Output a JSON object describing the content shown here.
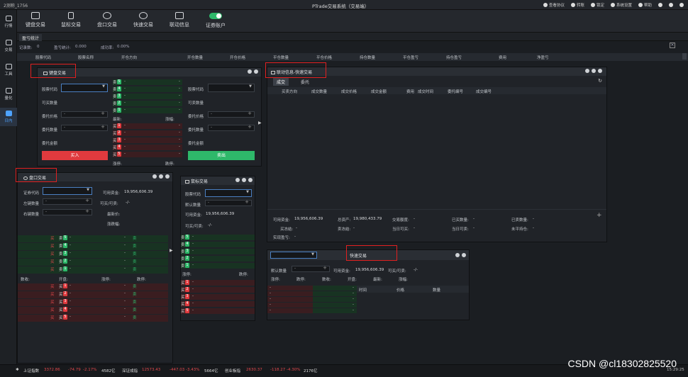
{
  "title_bar": {
    "account": "2测称_1756",
    "app_title": "PTrade交易系统（交易端）",
    "actions": [
      "查看协议",
      "转账",
      "锁定",
      "系统设置",
      "帮助"
    ]
  },
  "left_nav": [
    {
      "label": "行情",
      "icon": "chart-icon"
    },
    {
      "label": "交易",
      "icon": "trade-icon"
    },
    {
      "label": "工具",
      "icon": "toolbox-icon"
    },
    {
      "label": "量化",
      "icon": "quant-icon"
    },
    {
      "label": "日内",
      "icon": "intraday-icon"
    }
  ],
  "toolbar": [
    {
      "label": "键盘交易",
      "icon": "keyboard-icon"
    },
    {
      "label": "鼠标交易",
      "icon": "mouse-icon"
    },
    {
      "label": "盘口交易",
      "icon": "orderbook-icon"
    },
    {
      "label": "快速交易",
      "icon": "lightning-icon"
    },
    {
      "label": "联动信息",
      "icon": "link-icon"
    },
    {
      "label": "证券账户",
      "icon": "toggle-icon"
    }
  ],
  "sub_tab": "盈亏统计",
  "stats": {
    "record_label": "记录数:",
    "record_val": "0",
    "pnl_label": "盈亏统计:",
    "pnl_val": "0.000",
    "rate_label": "成功率:",
    "rate_val": "0.00%"
  },
  "grid_columns": [
    "股票代码",
    "股票名称",
    "开仓方向",
    "开仓数量",
    "开仓价格",
    "平仓数量",
    "平仓价格",
    "持仓数量",
    "平仓盈亏",
    "持仓盈亏",
    "费用",
    "净盈亏"
  ],
  "keyboard_panel": {
    "title": "键盘交易",
    "left_labels": [
      "股票代码",
      "可买数量",
      "委托价格",
      "委托数量",
      "委托金额"
    ],
    "right_labels": [
      "股票代码",
      "可卖数量",
      "委托价格",
      "委托数量",
      "委托金额"
    ],
    "buy_btn": "买入",
    "sell_btn": "卖出",
    "latest_label": "最新:",
    "change_label": "涨幅:",
    "limit_up_label": "涨停:",
    "limit_down_label": "跌停:",
    "dash": "-"
  },
  "panel_quotes": {
    "sell_tag": "卖",
    "buy_tag": "买",
    "levels": [
      "5",
      "4",
      "3",
      "2",
      "1"
    ],
    "levels_buy": [
      "1",
      "2",
      "3",
      "4",
      "5"
    ]
  },
  "orderbook_panel": {
    "title": "盘口交易",
    "labels": [
      "证券代码",
      "左键数量",
      "右键数量"
    ],
    "avail_funds_label": "可用资金:",
    "avail_funds": "19,956,606.39",
    "buy_sell_label": "可买/可卖:",
    "buy_sell_val": "-/-",
    "latest_label": "最新价:",
    "change_label": "涨跌幅:",
    "row_labels": [
      "数收:",
      "开盘:",
      "涨停:",
      "跌停:"
    ]
  },
  "mouse_panel": {
    "title": "鼠标交易",
    "labels": [
      "股票代码",
      "默认数量"
    ],
    "avail_funds_label": "可用资金:",
    "avail_funds": "19,956,606.39",
    "buy_sell_label": "可买/可卖:",
    "buy_sell_val": "-/-",
    "limit_up_label": "涨停:",
    "limit_down_label": "跌停:"
  },
  "link_panel": {
    "title": "联动信息-快速交易",
    "tabs": [
      "成交",
      "委托"
    ],
    "columns": [
      "买卖方向",
      "成交数量",
      "成交价格",
      "成交金额",
      "费用",
      "成交时间",
      "委托编号",
      "成交编号"
    ],
    "summary": {
      "avail_label": "可用资金:",
      "avail": "19,956,606.39",
      "total_label": "总资产:",
      "total": "19,980,433.79",
      "quota_label": "交易额度:",
      "quota": "-",
      "bought_label": "已买数量:",
      "bought": "-",
      "sold_label": "已卖数量:",
      "sold": "-",
      "frozen_buy_label": "买冻结:",
      "frozen_buy": "-",
      "frozen_sell_label": "卖冻结:",
      "frozen_sell": "-",
      "today_buy_label": "当日可买:",
      "today_buy": "-",
      "today_sell_label": "当日可卖:",
      "today_sell": "-",
      "unclosed_label": "未平持仓:",
      "unclosed": "-",
      "realized_label": "实现盈亏:",
      "realized": "-"
    }
  },
  "quick_panel": {
    "title": "快速交易",
    "default_qty_label": "默认数量",
    "avail_funds_label": "可用资金:",
    "avail_funds": "19,956,606.39",
    "buy_sell_label": "可买/可卖:",
    "buy_sell_val": "-/-",
    "row_labels": [
      "涨停:",
      "跌停:",
      "数收:",
      "开盘:",
      "最新:",
      "涨幅:"
    ],
    "columns": [
      "时间",
      "价格",
      "数量"
    ]
  },
  "footer": {
    "items": [
      {
        "name": "上证指数",
        "value": "3372.86",
        "chg": "-74.79",
        "pct": "-2.17%",
        "vol": "4582亿"
      },
      {
        "name": "深证成指",
        "value": "12573.43",
        "chg": "-447.03",
        "pct": "-3.43%",
        "vol": "5664亿"
      },
      {
        "name": "创业板指",
        "value": "2630.37",
        "chg": "-118.27",
        "pct": "-4.30%",
        "vol": "2176亿"
      }
    ],
    "right_time": "15:29:25"
  },
  "watermark": "CSDN @cl18302825520",
  "colors": {
    "buy": "#e03a3e",
    "sell": "#2eb86a",
    "accent": "#4ea3ff",
    "highlight_box": "#e02020"
  }
}
